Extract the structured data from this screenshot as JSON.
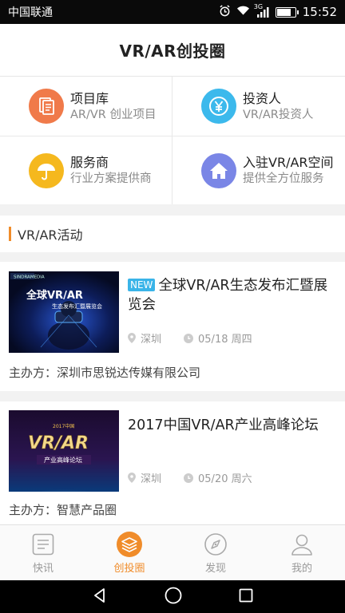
{
  "status_bar": {
    "carrier": "中国联通",
    "network": "3G",
    "time": "15:52"
  },
  "header": {
    "title": "VR/AR创投圈"
  },
  "grid": [
    {
      "title": "项目库",
      "subtitle": "AR/VR 创业项目",
      "icon": "document-icon",
      "color": "#f07a4a"
    },
    {
      "title": "投资人",
      "subtitle": "VR/AR投资人",
      "icon": "yen-icon",
      "color": "#3cb9ec"
    },
    {
      "title": "服务商",
      "subtitle": "行业方案提供商",
      "icon": "umbrella-icon",
      "color": "#f5b81e"
    },
    {
      "title": "入驻VR/AR空间",
      "subtitle": "提供全方位服务",
      "icon": "home-icon",
      "color": "#7a86e6"
    }
  ],
  "section": {
    "label": "VR/AR活动"
  },
  "events": [
    {
      "badge": "NEW",
      "title": "全球VR/AR生态发布汇暨展览会",
      "location": "深圳",
      "date": "05/18 周四",
      "host": "主办方：深圳市思锐达传媒有限公司",
      "poster_text": "全球VR/AR",
      "poster_sub": "生态发布汇暨展览会"
    },
    {
      "badge": "",
      "title": "2017中国VR/AR产业高峰论坛",
      "location": "深圳",
      "date": "05/20 周六",
      "host": "主办方：智慧产品圈",
      "poster_text": "VR/AR",
      "poster_sub": "产业高峰论坛",
      "poster_top": "2017中国"
    }
  ],
  "tabbar": [
    {
      "label": "快讯",
      "icon": "news-icon",
      "active": false
    },
    {
      "label": "创投圈",
      "icon": "layers-icon",
      "active": true
    },
    {
      "label": "发现",
      "icon": "compass-icon",
      "active": false
    },
    {
      "label": "我的",
      "icon": "person-icon",
      "active": false
    }
  ],
  "colors": {
    "accent": "#f08c2a",
    "new_badge": "#3ab4e8"
  }
}
